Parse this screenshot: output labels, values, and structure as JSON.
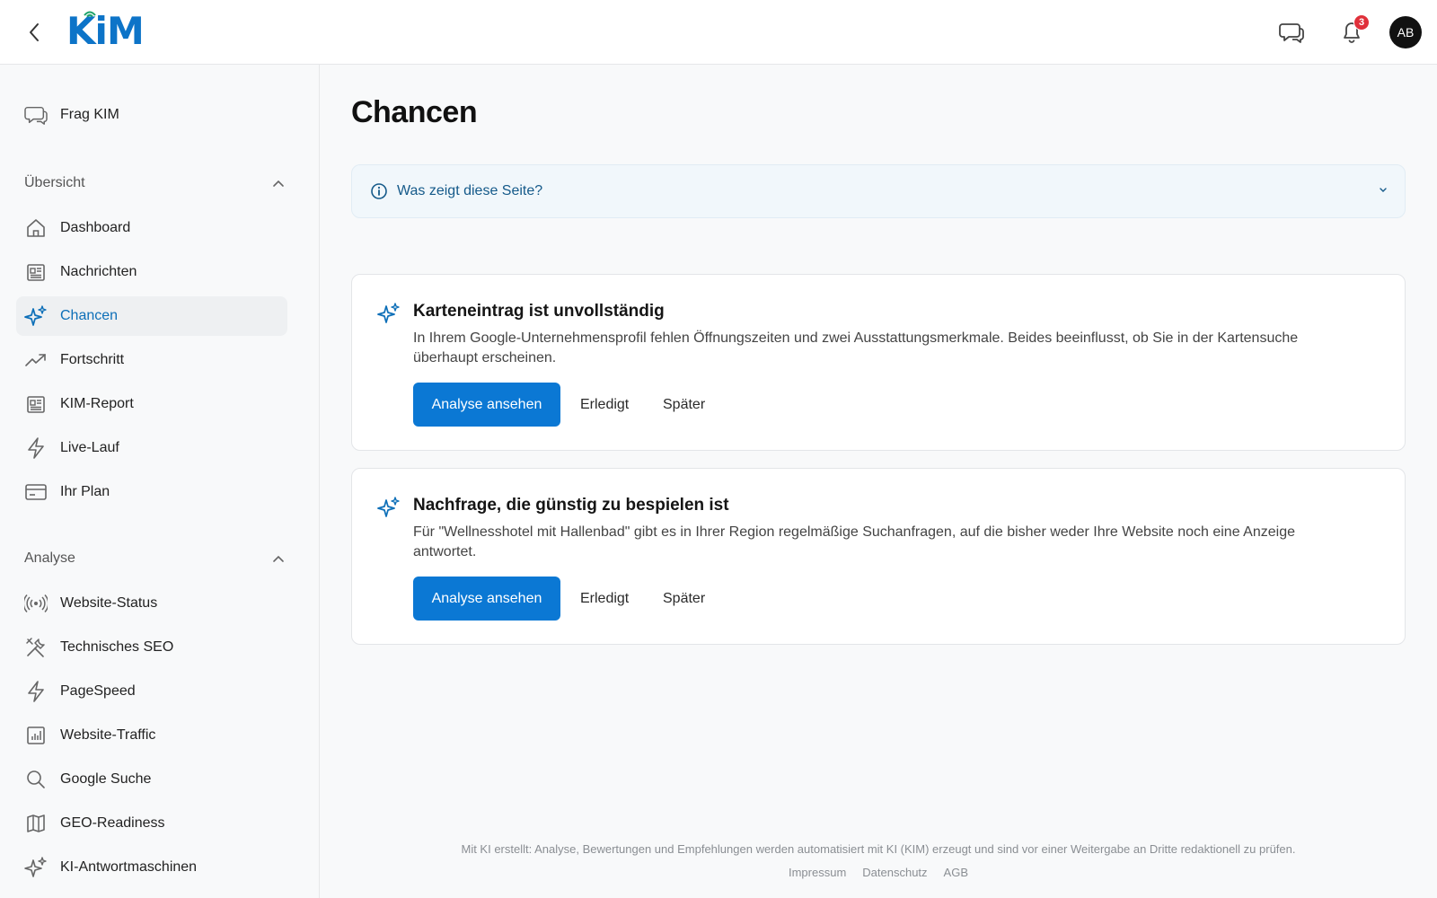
{
  "header": {
    "logo_text": "KiM",
    "notification_count": "3",
    "avatar_initials": "AB"
  },
  "sidebar": {
    "ask": {
      "label": "Frag KIM",
      "icon": "chat-icon"
    },
    "sections": [
      {
        "title": "Übersicht",
        "items": [
          {
            "label": "Dashboard",
            "icon": "home-icon"
          },
          {
            "label": "Nachrichten",
            "icon": "newspaper-icon"
          },
          {
            "label": "Chancen",
            "icon": "sparkles-icon",
            "active": true
          },
          {
            "label": "Fortschritt",
            "icon": "trend-up-icon"
          },
          {
            "label": "KIM-Report",
            "icon": "newspaper-icon"
          },
          {
            "label": "Live-Lauf",
            "icon": "lightning-icon"
          },
          {
            "label": "Ihr Plan",
            "icon": "credit-card-icon"
          }
        ]
      },
      {
        "title": "Analyse",
        "items": [
          {
            "label": "Website-Status",
            "icon": "broadcast-icon"
          },
          {
            "label": "Technisches SEO",
            "icon": "tools-icon"
          },
          {
            "label": "PageSpeed",
            "icon": "lightning-icon"
          },
          {
            "label": "Website-Traffic",
            "icon": "bar-chart-icon"
          },
          {
            "label": "Google Suche",
            "icon": "search-icon"
          },
          {
            "label": "GEO-Readiness",
            "icon": "map-icon"
          },
          {
            "label": "KI-Antwortmaschinen",
            "icon": "sparkles-icon"
          }
        ]
      }
    ]
  },
  "main": {
    "title": "Chancen",
    "info_toggle": "Was zeigt diese Seite?",
    "cards": [
      {
        "title": "Karteneintrag ist unvollständig",
        "description": "In Ihrem Google-Unternehmensprofil fehlen Öffnungszeiten und zwei Ausstattungsmerkmale. Beides beeinflusst, ob Sie in der Kartensuche überhaupt erscheinen.",
        "primary": "Analyse ansehen",
        "done": "Erledigt",
        "later": "Später"
      },
      {
        "title": "Nachfrage, die günstig zu bespielen ist",
        "description": "Für \"Wellnesshotel mit Hallenbad\" gibt es in Ihrer Region regelmäßige Suchanfragen, auf die bisher weder Ihre Website noch eine Anzeige antwortet.",
        "primary": "Analyse ansehen",
        "done": "Erledigt",
        "later": "Später"
      }
    ]
  },
  "footer": {
    "note": "Mit KI erstellt: Analyse, Bewertungen und Empfehlungen werden automatisiert mit KI (KIM) erzeugt und sind vor einer Weitergabe an Dritte redaktionell zu prüfen.",
    "links": [
      "Impressum",
      "Datenschutz",
      "AGB"
    ]
  },
  "colors": {
    "accent": "#0b78d4",
    "active_text": "#0d6fb8",
    "badge": "#e0303a"
  }
}
